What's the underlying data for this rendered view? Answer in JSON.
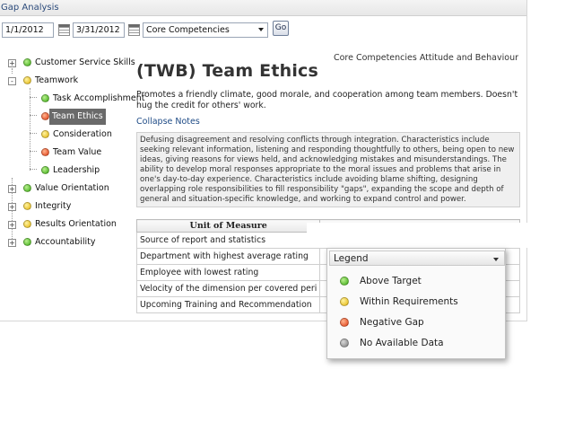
{
  "window": {
    "title": "Gap Analysis"
  },
  "toolbar": {
    "start_date": "1/1/2012",
    "end_date": "3/31/2012",
    "category_selected": "Core Competencies",
    "go_label": "Go"
  },
  "tree": {
    "items": [
      {
        "label": "Customer Service Skills",
        "status": "green",
        "level": 0,
        "expander": "+"
      },
      {
        "label": "Teamwork",
        "status": "yellow",
        "level": 0,
        "expander": "-"
      },
      {
        "label": "Task Accomplishment",
        "status": "green",
        "level": 1
      },
      {
        "label": "Team Ethics",
        "status": "red",
        "level": 1,
        "selected": true
      },
      {
        "label": "Consideration",
        "status": "yellow",
        "level": 1
      },
      {
        "label": "Team Value",
        "status": "red",
        "level": 1
      },
      {
        "label": "Leadership",
        "status": "green",
        "level": 1
      },
      {
        "label": "Value Orientation",
        "status": "green",
        "level": 0,
        "expander": "+"
      },
      {
        "label": "Integrity",
        "status": "yellow",
        "level": 0,
        "expander": "+"
      },
      {
        "label": "Results Orientation",
        "status": "yellow",
        "level": 0,
        "expander": "+"
      },
      {
        "label": "Accountability",
        "status": "green",
        "level": 0,
        "expander": "+"
      }
    ]
  },
  "content": {
    "subtitle": "Core Competencies Attitude and Behaviour",
    "heading": "(TWB) Team Ethics",
    "description": "Promotes a friendly climate, good morale, and cooperation among team members. Doesn't hug the credit for others' work.",
    "collapse_label": "Collapse Notes",
    "notes": "Defusing disagreement and resolving conflicts through integration. Characteristics include seeking relevant information, listening and responding thoughtfully to others, being open to new ideas, giving reasons for views held, and acknowledging mistakes and misunderstandings.  The ability to develop moral responses appropriate to the moral issues and problems that arise in one's day-to-day experience. Characteristics include avoiding blame shifting, designing overlapping role responsibilities to fill responsibility \"gaps\", expanding the scope and depth of general and situation-specific knowledge, and working to expand control and power."
  },
  "table": {
    "header": "Unit of Measure",
    "rows": [
      "Source of report and statistics",
      "Department with highest average rating",
      "Employee with lowest rating",
      "Velocity of the dimension per covered peri",
      "Upcoming Training and Recommendation"
    ]
  },
  "legend": {
    "title": "Legend",
    "items": [
      {
        "label": "Above Target",
        "color": "green"
      },
      {
        "label": "Within Requirements",
        "color": "yellow"
      },
      {
        "label": "Negative Gap",
        "color": "red"
      },
      {
        "label": "No Available Data",
        "color": "gray"
      }
    ]
  },
  "colors": {
    "link": "#1e4b86",
    "selected_bg": "#6a6a6a",
    "status_green": "#3cab14",
    "status_yellow": "#e3b40b",
    "status_red": "#df3b12",
    "status_gray": "#7d7d7d"
  }
}
